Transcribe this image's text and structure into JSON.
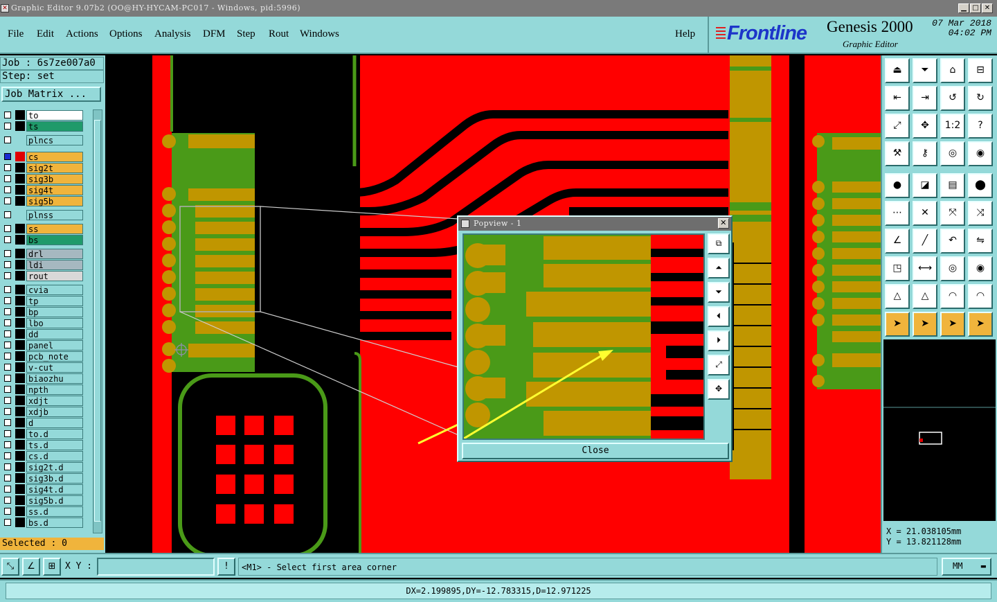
{
  "window": {
    "title": "Graphic Editor 9.07b2 (OO@HY-HYCAM-PC017 - Windows, pid:5996)"
  },
  "menu": {
    "items": [
      "File",
      "Edit",
      "Actions",
      "Options",
      "Analysis",
      "DFM",
      "Step",
      "Rout",
      "Windows"
    ],
    "help": "Help"
  },
  "brand": {
    "logo": "Frontline",
    "product": "Genesis 2000",
    "subtitle": "Graphic Editor",
    "date": "07 Mar 2018",
    "time": "04:02 PM"
  },
  "job": {
    "job_label": "Job : 6s7ze007a0",
    "step_label": "Step: set",
    "matrix_button": "Job Matrix ..."
  },
  "layers": [
    {
      "name": "to",
      "color": "#ffffff",
      "swatch": "#000000",
      "checked": false
    },
    {
      "name": "ts",
      "color": "#1f9a6a",
      "swatch": "#000000",
      "checked": false
    },
    {
      "name": "plncs",
      "color": "#94d9d9",
      "swatch": "#94d9d9",
      "checked": false
    },
    {
      "name": "cs",
      "color": "#f0b43c",
      "swatch": "#e00000",
      "checked": true
    },
    {
      "name": "sig2t",
      "color": "#f0b43c",
      "swatch": "#000000",
      "checked": false
    },
    {
      "name": "sig3b",
      "color": "#f0b43c",
      "swatch": "#000000",
      "checked": false
    },
    {
      "name": "sig4t",
      "color": "#f0b43c",
      "swatch": "#000000",
      "checked": false
    },
    {
      "name": "sig5b",
      "color": "#f0b43c",
      "swatch": "#000000",
      "checked": false
    },
    {
      "name": "plnss",
      "color": "#94d9d9",
      "swatch": "#94d9d9",
      "checked": false
    },
    {
      "name": "ss",
      "color": "#f0b43c",
      "swatch": "#000000",
      "checked": false
    },
    {
      "name": "bs",
      "color": "#1f9a6a",
      "swatch": "#000000",
      "checked": false
    },
    {
      "name": "drl",
      "color": "#a6b8c0",
      "swatch": "#000000",
      "checked": false
    },
    {
      "name": "ldi",
      "color": "#a6b8c0",
      "swatch": "#000000",
      "checked": false
    },
    {
      "name": "rout",
      "color": "#d8d8d8",
      "swatch": "#000000",
      "checked": false
    },
    {
      "name": "cvia",
      "color": "#94d9d9",
      "swatch": "#000000",
      "checked": false
    },
    {
      "name": "tp",
      "color": "#94d9d9",
      "swatch": "#000000",
      "checked": false
    },
    {
      "name": "bp",
      "color": "#94d9d9",
      "swatch": "#000000",
      "checked": false
    },
    {
      "name": "lbo",
      "color": "#94d9d9",
      "swatch": "#000000",
      "checked": false
    },
    {
      "name": "dd",
      "color": "#94d9d9",
      "swatch": "#000000",
      "checked": false
    },
    {
      "name": "panel",
      "color": "#94d9d9",
      "swatch": "#000000",
      "checked": false
    },
    {
      "name": "pcb_note",
      "color": "#94d9d9",
      "swatch": "#000000",
      "checked": false
    },
    {
      "name": "v-cut",
      "color": "#94d9d9",
      "swatch": "#000000",
      "checked": false
    },
    {
      "name": "biaozhu",
      "color": "#94d9d9",
      "swatch": "#000000",
      "checked": false
    },
    {
      "name": "npth",
      "color": "#94d9d9",
      "swatch": "#000000",
      "checked": false
    },
    {
      "name": "xdjt",
      "color": "#94d9d9",
      "swatch": "#000000",
      "checked": false
    },
    {
      "name": "xdjb",
      "color": "#94d9d9",
      "swatch": "#000000",
      "checked": false
    },
    {
      "name": "d",
      "color": "#94d9d9",
      "swatch": "#000000",
      "checked": false
    },
    {
      "name": "to.d",
      "color": "#94d9d9",
      "swatch": "#000000",
      "checked": false
    },
    {
      "name": "ts.d",
      "color": "#94d9d9",
      "swatch": "#000000",
      "checked": false
    },
    {
      "name": "cs.d",
      "color": "#94d9d9",
      "swatch": "#000000",
      "checked": false
    },
    {
      "name": "sig2t.d",
      "color": "#94d9d9",
      "swatch": "#000000",
      "checked": false
    },
    {
      "name": "sig3b.d",
      "color": "#94d9d9",
      "swatch": "#000000",
      "checked": false
    },
    {
      "name": "sig4t.d",
      "color": "#94d9d9",
      "swatch": "#000000",
      "checked": false
    },
    {
      "name": "sig5b.d",
      "color": "#94d9d9",
      "swatch": "#000000",
      "checked": false
    },
    {
      "name": "ss.d",
      "color": "#94d9d9",
      "swatch": "#000000",
      "checked": false
    },
    {
      "name": "bs.d",
      "color": "#94d9d9",
      "swatch": "#000000",
      "checked": false
    }
  ],
  "selected_label": "Selected : 0",
  "coords": {
    "x": "X = 21.038105mm",
    "y": "Y = 13.821128mm"
  },
  "command": {
    "xy_label": "X Y :",
    "xy_value": "",
    "message": "<M1> - Select first area corner",
    "units": "MM"
  },
  "status": "DX=2.199895,DY=-12.783315,D=12.971225",
  "popview": {
    "title": "Popview - 1",
    "close_label": "Close"
  },
  "tool_icons": [
    "home-up-icon",
    "home-down-icon",
    "home-icon",
    "grid-icon",
    "pan-left-icon",
    "pan-right-icon",
    "undo-icon",
    "redo-icon",
    "zoom-fit-icon",
    "zoom-center-icon",
    "one-to-one-icon",
    "help-icon",
    "measure-tool-icon",
    "key-icon",
    "layer-toggle-icon",
    "layer-swap-icon",
    "pad-icon",
    "polygon-icon",
    "ruler-icon",
    "dot-icon",
    "nodes-icon",
    "cross-icon",
    "point-to-point-icon",
    "line-snap-icon",
    "angle-icon",
    "slash-icon",
    "arc-icon",
    "mirror-icon",
    "box-snap-icon",
    "midline-icon",
    "center-icon",
    "circles-icon",
    "triangle-icon",
    "triangle-up-icon",
    "arch-icon",
    "arch-up-icon",
    "pointer-icon",
    "pointer-select-icon",
    "pointer-circle-icon",
    "pointer-net-icon"
  ],
  "colors": {
    "panel": "#94d9d9",
    "copper": "#ff0000",
    "mask": "#c09600",
    "trace": "#4a9a18",
    "accent": "#f0b43c"
  }
}
